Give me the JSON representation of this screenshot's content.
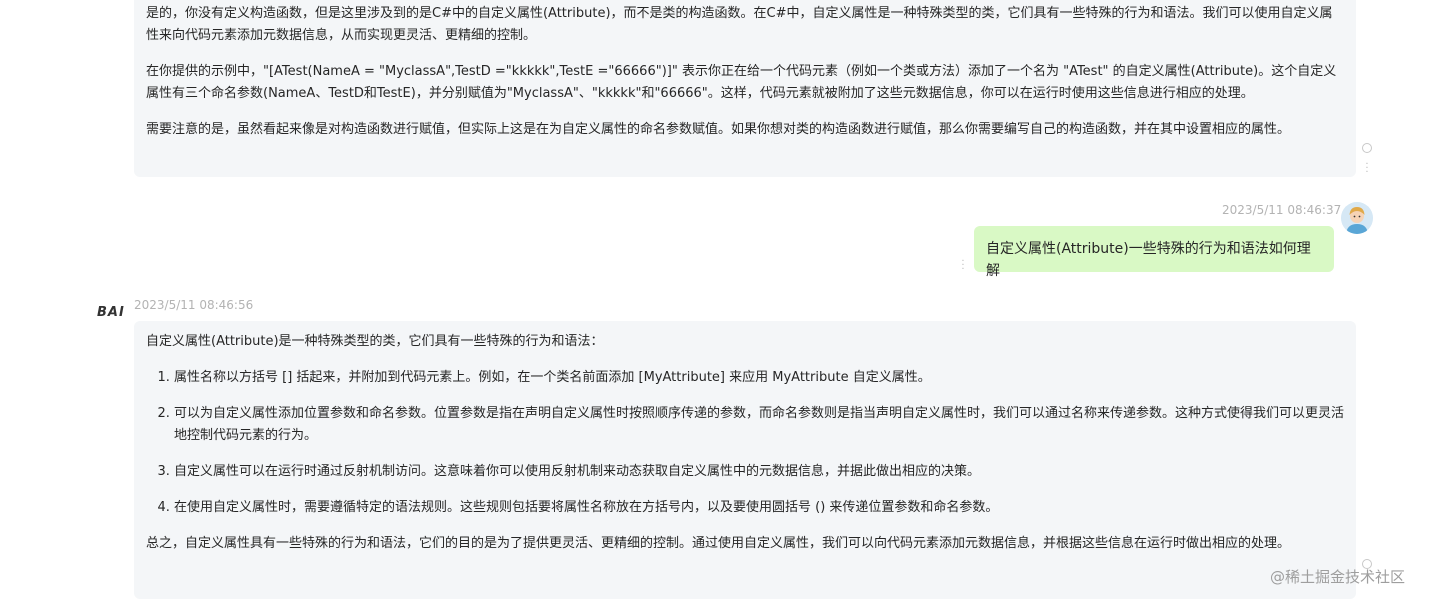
{
  "conversation": {
    "ai_message_1": {
      "paragraphs": [
        "是的，你没有定义构造函数，但是这里涉及到的是C#中的自定义属性(Attribute)，而不是类的构造函数。在C#中，自定义属性是一种特殊类型的类，它们具有一些特殊的行为和语法。我们可以使用自定义属性来向代码元素添加元数据信息，从而实现更灵活、更精细的控制。",
        "在你提供的示例中，\"[ATest(NameA = \"MyclassA\",TestD =\"kkkkk\",TestE =\"66666\")]\" 表示你正在给一个代码元素（例如一个类或方法）添加了一个名为 \"ATest\" 的自定义属性(Attribute)。这个自定义属性有三个命名参数(NameA、TestD和TestE)，并分别赋值为\"MyclassA\"、\"kkkkk\"和\"66666\"。这样，代码元素就被附加了这些元数据信息，你可以在运行时使用这些信息进行相应的处理。",
        "需要注意的是，虽然看起来像是对构造函数进行赋值，但实际上这是在为自定义属性的命名参数赋值。如果你想对类的构造函数进行赋值，那么你需要编写自己的构造函数，并在其中设置相应的属性。"
      ]
    },
    "user_message": {
      "timestamp": "2023/5/11 08:46:37",
      "text": "自定义属性(Attribute)一些特殊的行为和语法如何理解"
    },
    "ai_message_2": {
      "logo": "BAI",
      "timestamp": "2023/5/11 08:46:56",
      "intro": "自定义属性(Attribute)是一种特殊类型的类，它们具有一些特殊的行为和语法：",
      "list": [
        "属性名称以方括号 [] 括起来，并附加到代码元素上。例如，在一个类名前面添加 [MyAttribute] 来应用 MyAttribute 自定义属性。",
        "可以为自定义属性添加位置参数和命名参数。位置参数是指在声明自定义属性时按照顺序传递的参数，而命名参数则是指当声明自定义属性时，我们可以通过名称来传递参数。这种方式使得我们可以更灵活地控制代码元素的行为。",
        "自定义属性可以在运行时通过反射机制访问。这意味着你可以使用反射机制来动态获取自定义属性中的元数据信息，并据此做出相应的决策。",
        "在使用自定义属性时，需要遵循特定的语法规则。这些规则包括要将属性名称放在方括号内，以及要使用圆括号 () 来传递位置参数和命名参数。"
      ],
      "conclusion": "总之，自定义属性具有一些特殊的行为和语法，它们的目的是为了提供更灵活、更精细的控制。通过使用自定义属性，我们可以向代码元素添加元数据信息，并根据这些信息在运行时做出相应的处理。"
    }
  },
  "watermark": "@稀土掘金技术社区",
  "icons": {
    "more": "more-vertical-icon",
    "avatar": "user-avatar-icon",
    "loading": "ring-icon"
  }
}
